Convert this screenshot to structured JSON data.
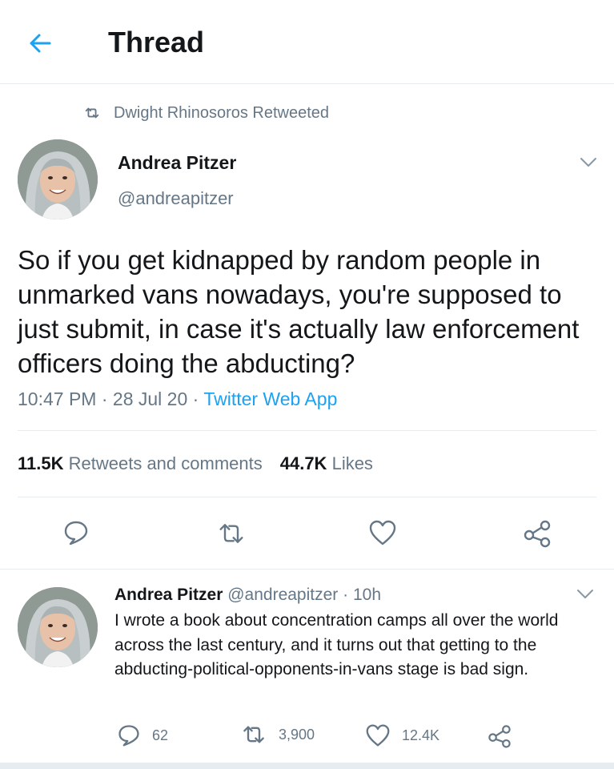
{
  "header": {
    "title": "Thread",
    "back_icon": "arrow-left-icon"
  },
  "retweet_context": {
    "icon": "retweet-icon",
    "text": "Dwight Rhinosoros Retweeted"
  },
  "main_tweet": {
    "author_name": "Andrea Pitzer",
    "author_handle": "@andreapitzer",
    "text": "So if you get kidnapped by random people in unmarked vans nowadays, you're supposed to just submit, in case it's actually law enforcement officers doing the abducting?",
    "time": "10:47 PM",
    "date": "28 Jul 20",
    "separator": "·",
    "source": "Twitter Web App",
    "stats": {
      "retweets_count": "11.5K",
      "retweets_label": "Retweets and comments",
      "likes_count": "44.7K",
      "likes_label": "Likes"
    }
  },
  "reply_tweet": {
    "author_name": "Andrea Pitzer",
    "author_handle": "@andreapitzer",
    "separator": "·",
    "time": "10h",
    "text": "I wrote a book about concentration camps all over the world across the last century, and it turns out that getting to the abducting-political-opponents-in-vans stage is bad sign.",
    "replies": "62",
    "retweets": "3,900",
    "likes": "12.4K"
  },
  "colors": {
    "accent": "#1da1f2",
    "secondary_text": "#657786",
    "divider": "#e6ecf0"
  }
}
